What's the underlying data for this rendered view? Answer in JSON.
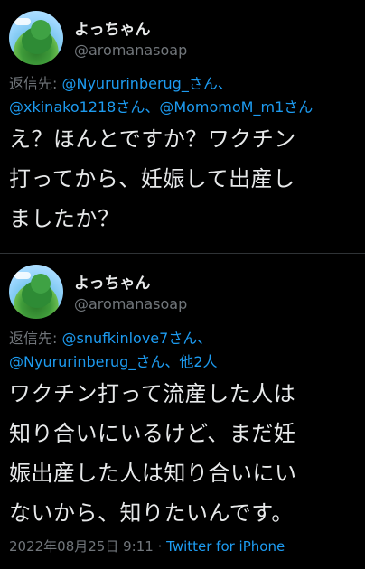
{
  "tweets": [
    {
      "name": "よっちゃん",
      "handle": "@aromanasoap",
      "reply_prefix": "返信先: ",
      "reply_line1_links": "@Nyururinberug_さん、",
      "reply_line2_links": "@xkinako1218さん、@MomomoM_m1さん",
      "body_lines": [
        "え？ほんとですか？ワクチン",
        "打ってから、妊娠して出産し",
        "ましたか？"
      ]
    },
    {
      "name": "よっちゃん",
      "handle": "@aromanasoap",
      "reply_prefix": "返信先: ",
      "reply_line1_links": "@snufkinlove7さん、",
      "reply_line2_links": "@Nyururinberug_さん、他2人",
      "body_lines": [
        "ワクチン打って流産した人は",
        "知り合いにいるけど、まだ妊",
        "娠出産した人は知り合いにい",
        "ないから、知りたいんです。"
      ],
      "timestamp": "2022年08月25日 9:11",
      "separator": " · ",
      "source": "Twitter for iPhone"
    }
  ]
}
